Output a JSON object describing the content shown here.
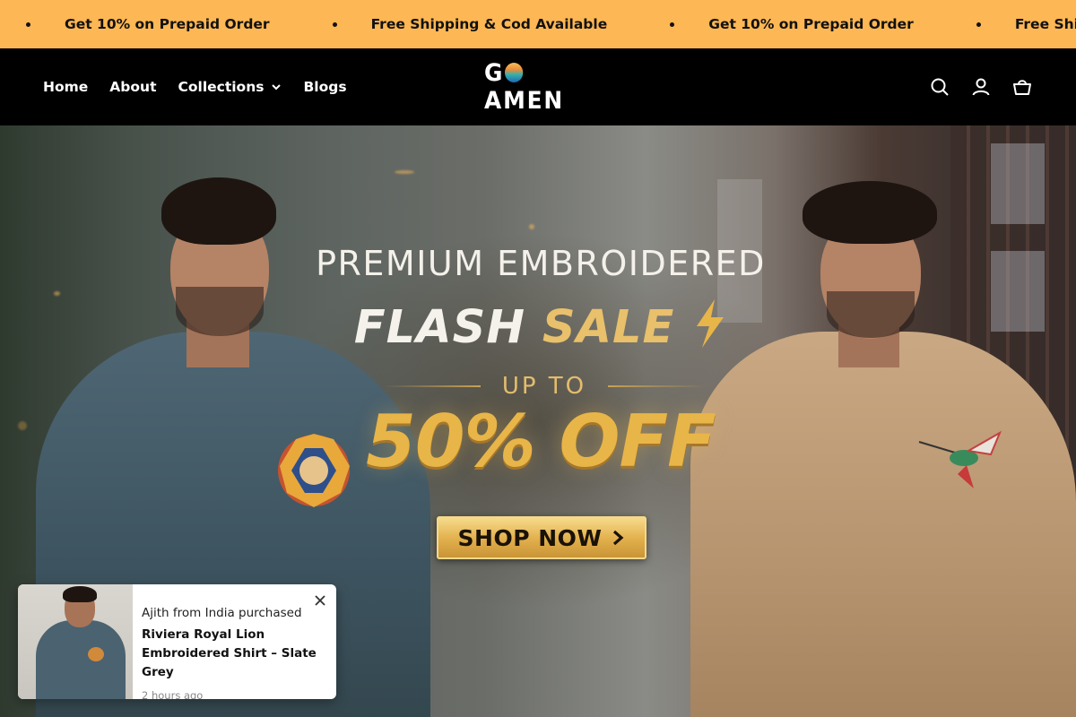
{
  "announcement": {
    "messages": [
      "Get 10% on Prepaid Order",
      "Free Shipping & Cod Available",
      "Get 10% on Prepaid Order",
      "Free Shipping & Cod Available"
    ]
  },
  "header": {
    "logo_text": "GOAMEN",
    "nav": [
      {
        "label": "Home"
      },
      {
        "label": "About"
      },
      {
        "label": "Collections",
        "has_dropdown": true
      },
      {
        "label": "Blogs"
      }
    ],
    "icons": [
      "search-icon",
      "account-icon",
      "cart-icon"
    ]
  },
  "hero": {
    "line1": "PREMIUM EMBROIDERED",
    "line2_a": "FLASH",
    "line2_b": "SALE",
    "upto": "UP TO",
    "discount": "50% OFF",
    "cta_label": "SHOP NOW",
    "colors": {
      "gold": "#e8b548",
      "cream": "#f4f1ea"
    }
  },
  "popup": {
    "who": "Ajith from India purchased",
    "product": "Riviera Royal Lion Embroidered Shirt – Slate Grey",
    "time": "2 hours ago"
  },
  "colors": {
    "announce_bg": "#fdb754",
    "header_bg": "#000000"
  }
}
